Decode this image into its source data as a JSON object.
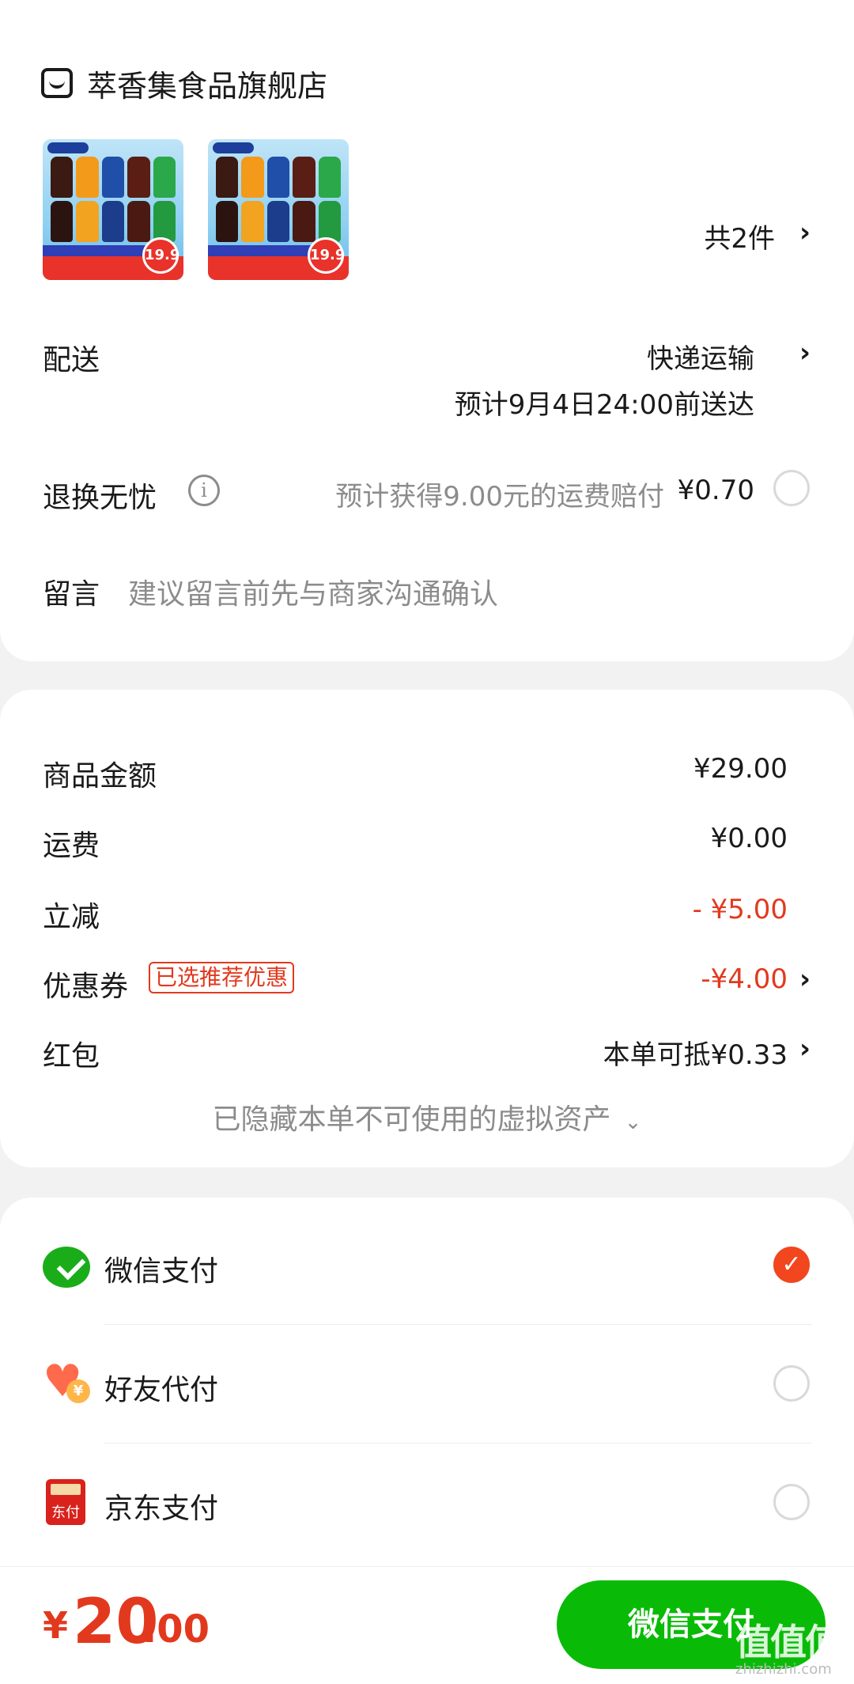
{
  "store": {
    "icon": "store-icon",
    "name": "萃香集食品旗舰店"
  },
  "products": {
    "thumb_price": "19.9",
    "count_label": "共2件"
  },
  "delivery": {
    "label": "配送",
    "method": "快递运输",
    "eta": "预计9月4日24:00前送达"
  },
  "return_insurance": {
    "label": "退换无忧",
    "info_icon": "info-icon",
    "description": "预计获得9.00元的运费赔付",
    "price": "¥0.70",
    "selected": false
  },
  "message": {
    "label": "留言",
    "placeholder": "建议留言前先与商家沟通确认"
  },
  "summary": {
    "goods_label": "商品金额",
    "goods_value": "¥29.00",
    "shipping_label": "运费",
    "shipping_value": "¥0.00",
    "discount_label": "立减",
    "discount_value": "- ¥5.00",
    "coupon_label": "优惠券",
    "coupon_badge": "已选推荐优惠",
    "coupon_value": "-¥4.00",
    "redpacket_label": "红包",
    "redpacket_value": "本单可抵¥0.33",
    "hidden_assets": "已隐藏本单不可使用的虚拟资产"
  },
  "payment_methods": [
    {
      "label": "微信支付",
      "icon": "wechat-pay-icon",
      "selected": true
    },
    {
      "label": "好友代付",
      "icon": "friend-pay-icon",
      "selected": false
    },
    {
      "label": "京东支付",
      "icon": "jd-pay-icon",
      "selected": false
    }
  ],
  "bottom": {
    "currency": "¥",
    "total_int": "20",
    "total_dec": ".00",
    "pay_button": "微信支付",
    "watermark": "值值值",
    "watermark_sub": "zhizhizhi.com"
  },
  "colors": {
    "accent_red": "#e2391e",
    "wechat_green": "#09bb07",
    "check_orange": "#f2461e"
  }
}
